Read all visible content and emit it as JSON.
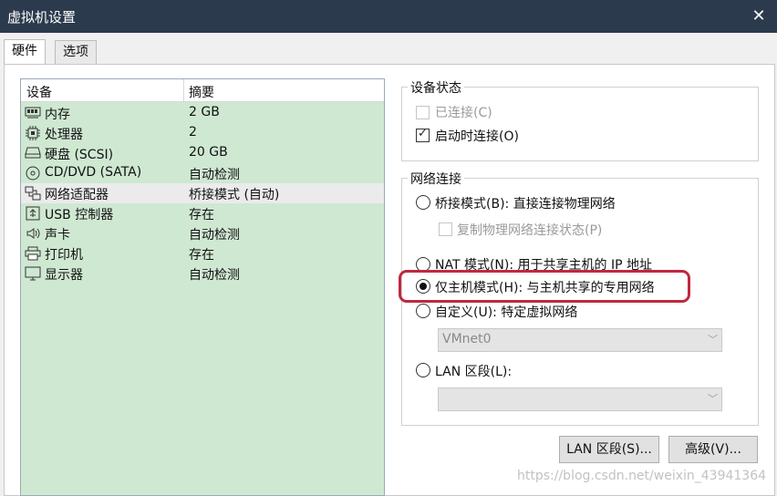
{
  "window": {
    "title": "虚拟机设置"
  },
  "tabs": [
    {
      "label": "硬件"
    },
    {
      "label": "选项"
    }
  ],
  "hardware": {
    "columns": {
      "device": "设备",
      "summary": "摘要"
    },
    "rows": [
      {
        "icon": "memory-icon",
        "device": "内存",
        "summary": "2 GB"
      },
      {
        "icon": "cpu-icon",
        "device": "处理器",
        "summary": "2"
      },
      {
        "icon": "hard-disk-icon",
        "device": "硬盘 (SCSI)",
        "summary": "20 GB"
      },
      {
        "icon": "cd-dvd-icon",
        "device": "CD/DVD (SATA)",
        "summary": "自动检测"
      },
      {
        "icon": "network-adapter-icon",
        "device": "网络适配器",
        "summary": "桥接模式 (自动)"
      },
      {
        "icon": "usb-icon",
        "device": "USB 控制器",
        "summary": "存在"
      },
      {
        "icon": "speaker-icon",
        "device": "声卡",
        "summary": "自动检测"
      },
      {
        "icon": "printer-icon",
        "device": "打印机",
        "summary": "存在"
      },
      {
        "icon": "monitor-icon",
        "device": "显示器",
        "summary": "自动检测"
      }
    ]
  },
  "device_status": {
    "legend": "设备状态",
    "connected": {
      "label": "已连接(C)",
      "checked": false,
      "disabled": true
    },
    "connect_at_power_on": {
      "label": "启动时连接(O)",
      "checked": true
    }
  },
  "network": {
    "legend": "网络连接",
    "bridged": {
      "label": "桥接模式(B): 直接连接物理网络"
    },
    "replicate": {
      "label": "复制物理网络连接状态(P)"
    },
    "nat": {
      "label": "NAT 模式(N): 用于共享主机的 IP 地址"
    },
    "host_only": {
      "label": "仅主机模式(H): 与主机共享的专用网络",
      "selected": true
    },
    "custom": {
      "label": "自定义(U): 特定虚拟网络"
    },
    "custom_value": "VMnet0",
    "lan_segment": {
      "label": "LAN 区段(L):"
    },
    "lan_value": ""
  },
  "buttons": {
    "lan_segments": "LAN 区段(S)...",
    "advanced": "高级(V)..."
  },
  "watermark": "https://blog.csdn.net/weixin_43941364",
  "colors": {
    "titlebar": "#2b3a4d",
    "list_bg": "#cfe8d2",
    "highlight": "#c0283f"
  }
}
